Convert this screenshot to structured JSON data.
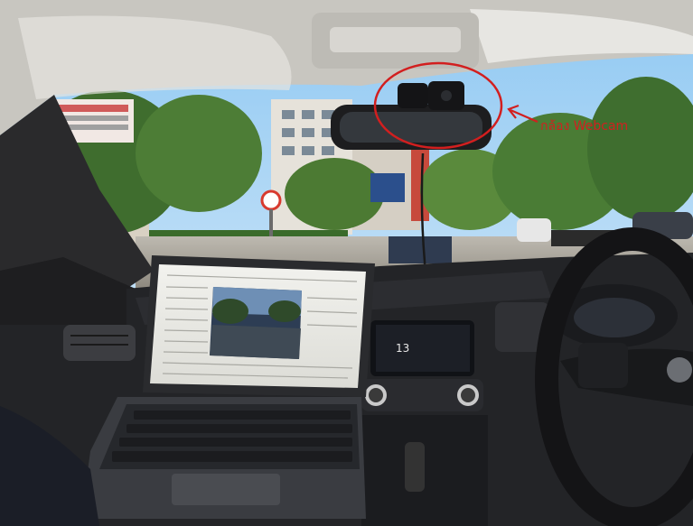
{
  "annotation": {
    "label": "กล้อง Webcam",
    "color": "#d21f1f"
  },
  "dashboard": {
    "clock": "13"
  },
  "scene": {
    "subjects": [
      "windshield",
      "rear-view-mirror",
      "webcam",
      "laptop",
      "dashboard",
      "steering-wheel",
      "street",
      "trees",
      "buildings"
    ]
  }
}
